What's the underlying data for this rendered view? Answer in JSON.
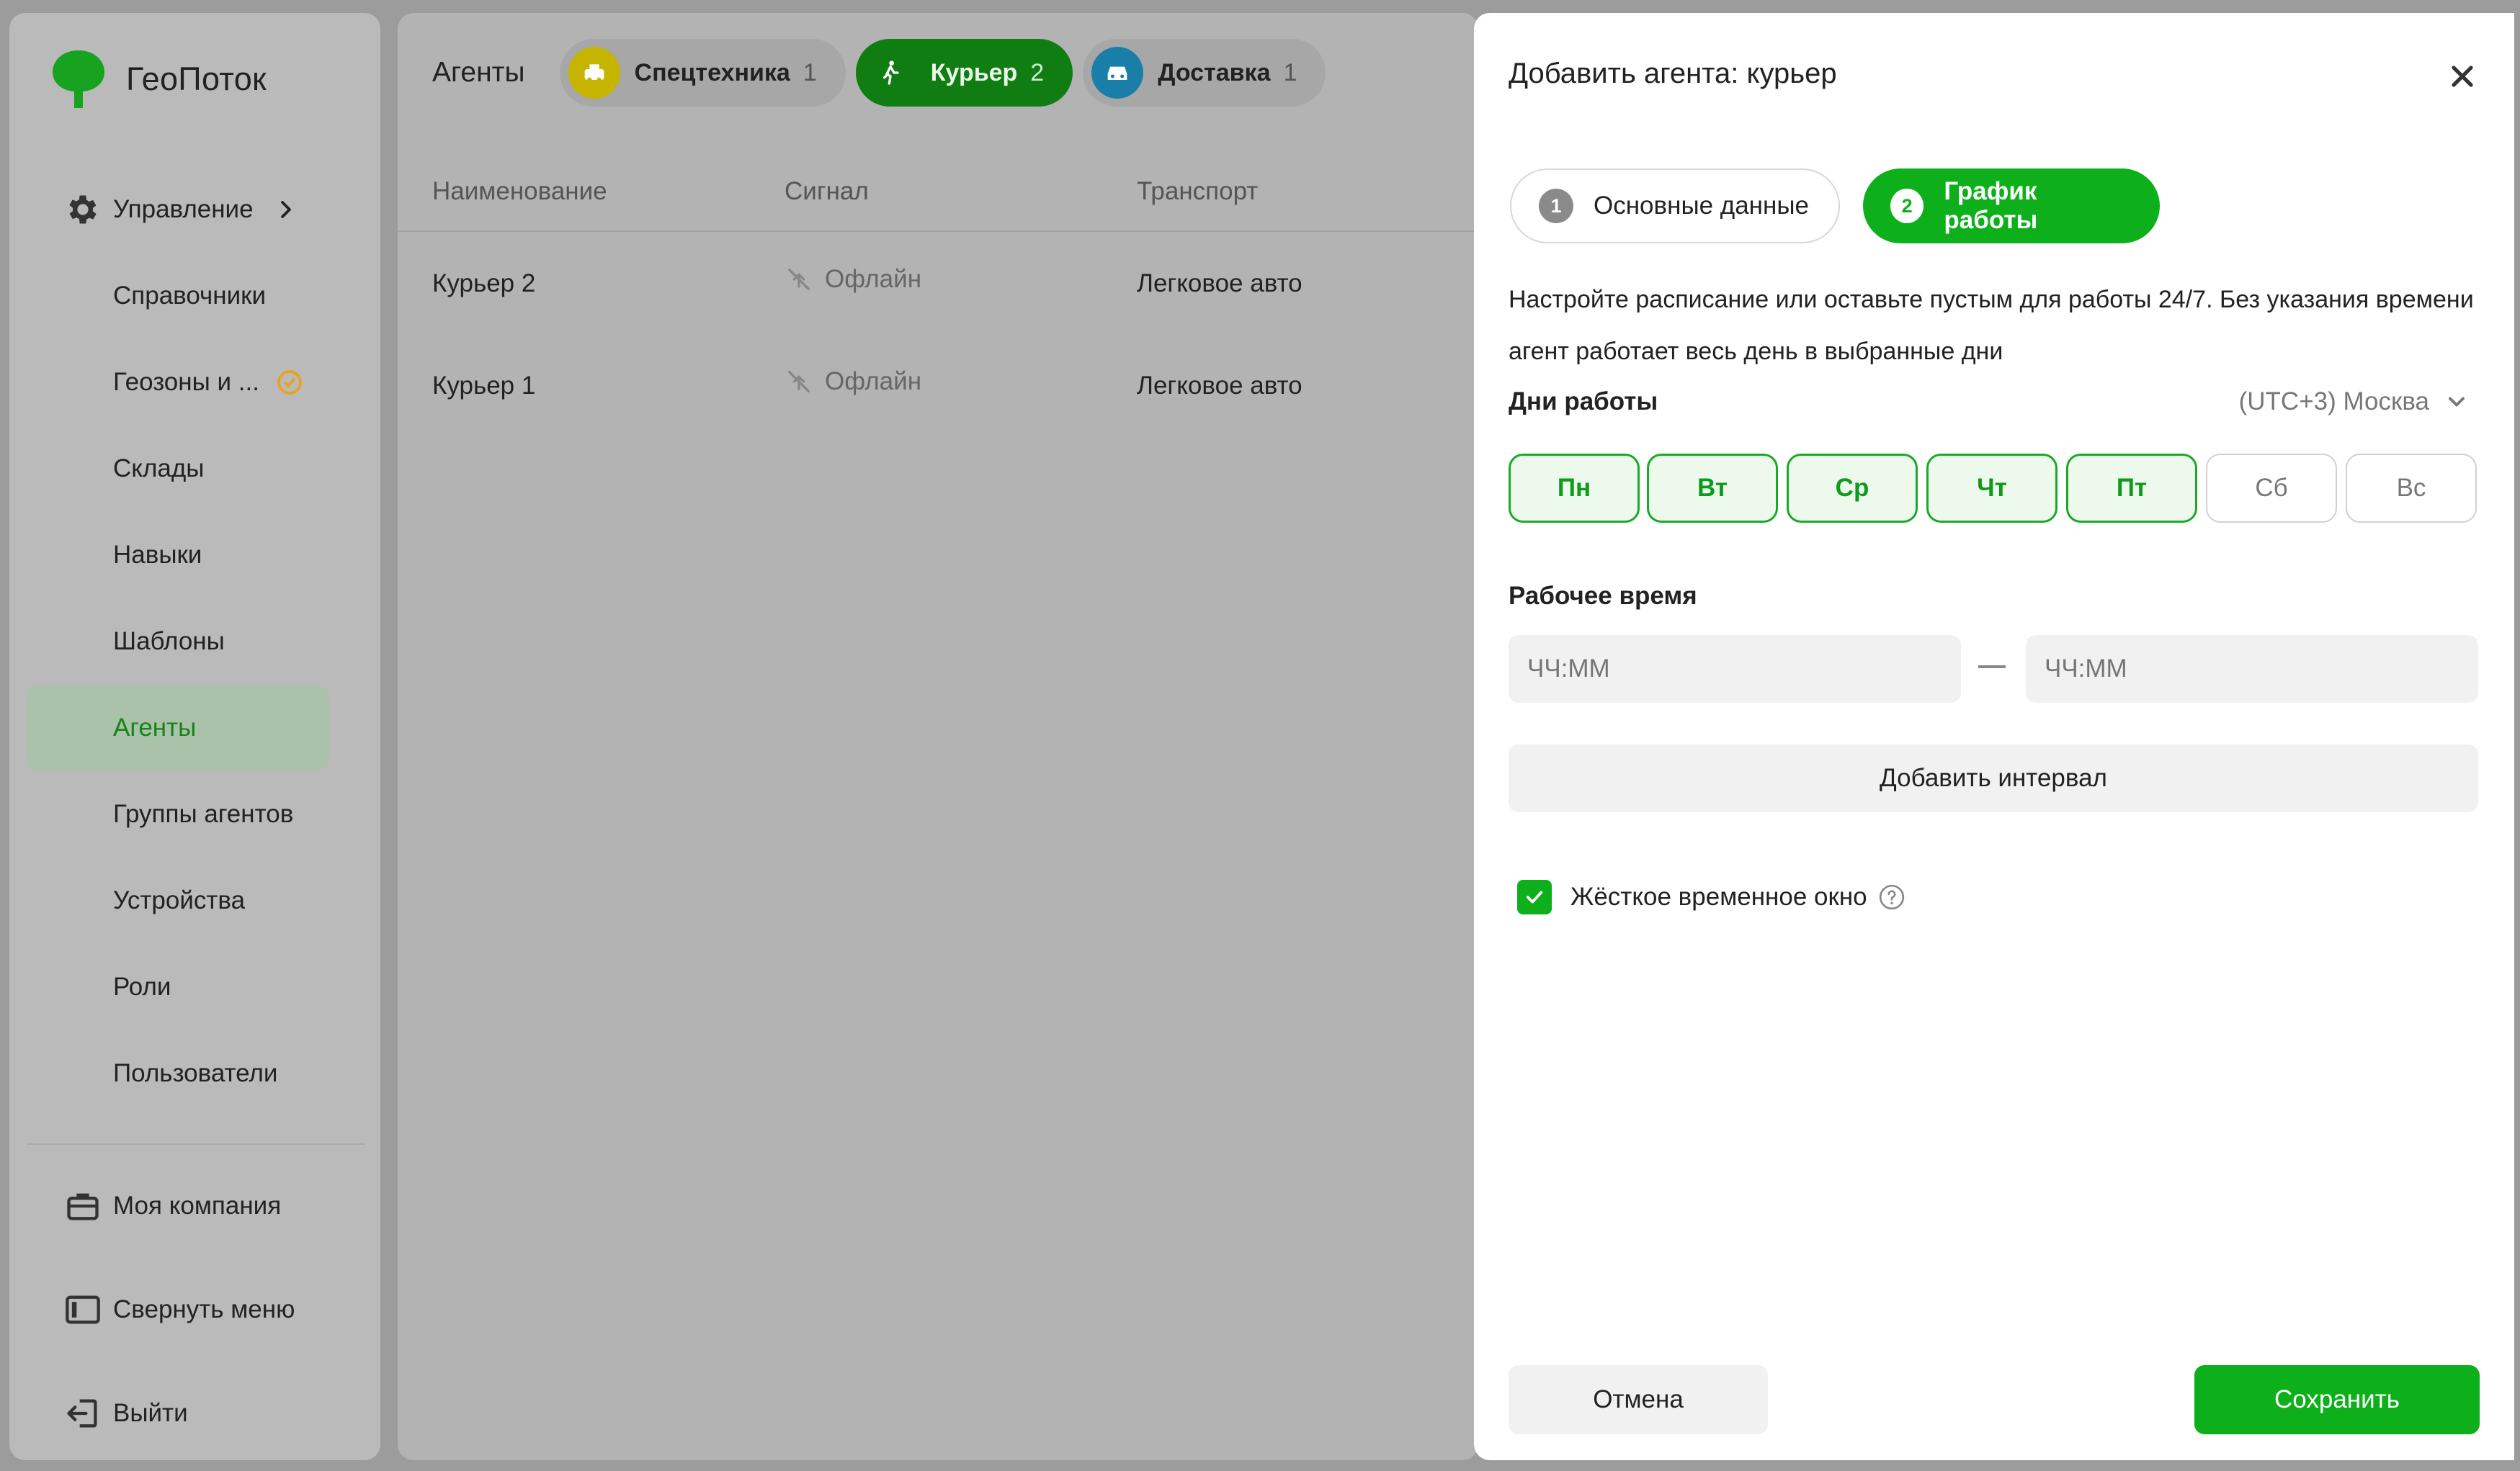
{
  "app": {
    "name": "ГеоПоток"
  },
  "sidebar": {
    "management": {
      "label": "Управление"
    },
    "items": [
      {
        "label": "Справочники"
      },
      {
        "label": "Геозоны и ..."
      },
      {
        "label": "Склады"
      },
      {
        "label": "Навыки"
      },
      {
        "label": "Шаблоны"
      },
      {
        "label": "Агенты",
        "active": true
      },
      {
        "label": "Группы агентов"
      },
      {
        "label": "Устройства"
      },
      {
        "label": "Роли"
      },
      {
        "label": "Пользователи"
      }
    ],
    "bottom": [
      {
        "label": "Моя компания"
      },
      {
        "label": "Свернуть меню"
      },
      {
        "label": "Выйти"
      }
    ]
  },
  "main": {
    "title": "Агенты",
    "chips": [
      {
        "label": "Спецтехника",
        "count": "1",
        "icon": "special-vehicle-icon",
        "color": "#c6b500"
      },
      {
        "label": "Курьер",
        "count": "2",
        "icon": "walking-courier-icon",
        "color": "#0f7d12",
        "active": true
      },
      {
        "label": "Доставка",
        "count": "1",
        "icon": "car-icon",
        "color": "#1a7fa8"
      }
    ],
    "columns": [
      "Наименование",
      "Сигнал",
      "Транспорт"
    ],
    "rows": [
      {
        "name": "Курьер 2",
        "signal": "Офлайн",
        "transport": "Легковое авто"
      },
      {
        "name": "Курьер 1",
        "signal": "Офлайн",
        "transport": "Легковое авто"
      }
    ]
  },
  "drawer": {
    "title": "Добавить агента: курьер",
    "steps": [
      {
        "num": "1",
        "label": "Основные данные",
        "state": "done"
      },
      {
        "num": "2",
        "label": "График работы",
        "state": "current"
      }
    ],
    "hint": "Настройте расписание или оставьте пустым для работы 24/7. Без указания времени агент работает весь день в выбранные дни",
    "work_days_label": "Дни работы",
    "timezone": "(UTC+3) Москва",
    "days": [
      {
        "label": "Пн",
        "selected": true
      },
      {
        "label": "Вт",
        "selected": true
      },
      {
        "label": "Ср",
        "selected": true
      },
      {
        "label": "Чт",
        "selected": true
      },
      {
        "label": "Пт",
        "selected": true
      },
      {
        "label": "Сб",
        "selected": false
      },
      {
        "label": "Вс",
        "selected": false
      }
    ],
    "work_time_label": "Рабочее время",
    "time_from_placeholder": "ЧЧ:ММ",
    "time_to_placeholder": "ЧЧ:ММ",
    "add_interval_label": "Добавить интервал",
    "hard_window": {
      "label": "Жёсткое временное окно",
      "checked": true
    },
    "cancel_label": "Отмена",
    "save_label": "Сохранить"
  },
  "colors": {
    "accent": "#0db01a",
    "accent_dark": "#107d13",
    "warning": "#e8a317"
  }
}
